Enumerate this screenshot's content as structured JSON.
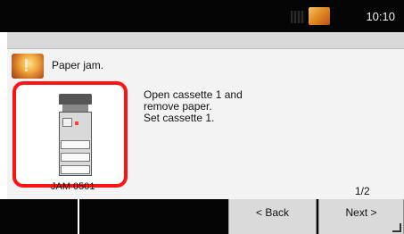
{
  "statusbar": {
    "time": "10:10"
  },
  "alert": {
    "title": "Paper jam.",
    "instructions": [
      "Open cassette 1 and",
      "remove paper.",
      "Set cassette 1."
    ],
    "model": "JAM 0501"
  },
  "pagination": {
    "label": "1/2"
  },
  "footer": {
    "back_label": "< Back",
    "next_label": "Next >"
  },
  "icons": {
    "warning": "warning-icon",
    "status": "status-icon",
    "printer": "printer-icon"
  },
  "colors": {
    "highlight_border": "#ff1212",
    "bar_background": "#050505",
    "button_background": "#dadada"
  }
}
